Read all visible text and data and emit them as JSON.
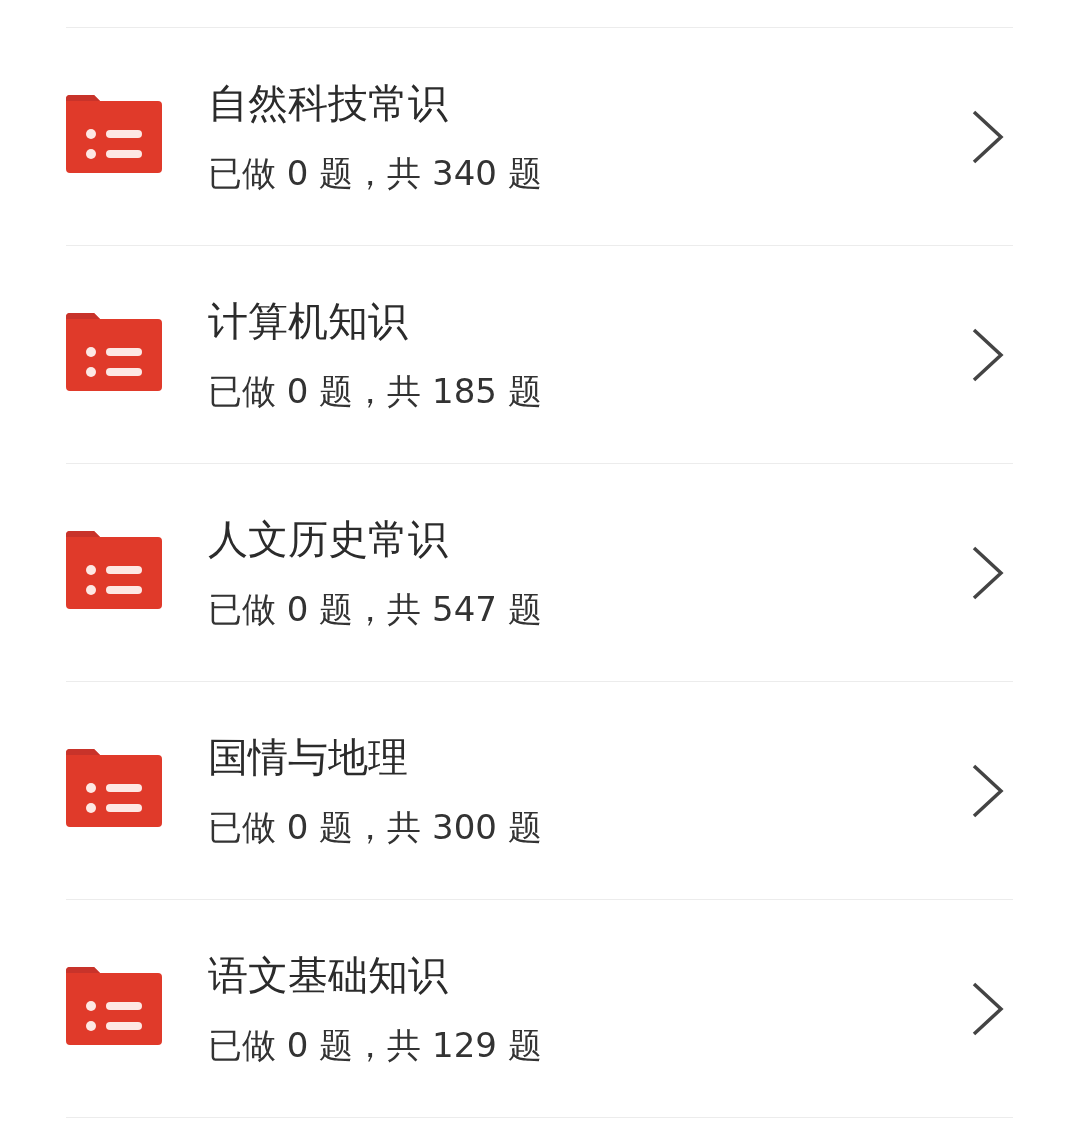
{
  "categories": [
    {
      "title": "自然科技常识",
      "progress": "已做 0 题，共 340 题"
    },
    {
      "title": "计算机知识",
      "progress": "已做 0 题，共 185 题"
    },
    {
      "title": "人文历史常识",
      "progress": "已做 0 题，共 547 题"
    },
    {
      "title": "国情与地理",
      "progress": "已做 0 题，共 300 题"
    },
    {
      "title": "语文基础知识",
      "progress": "已做 0 题，共 129 题"
    }
  ]
}
